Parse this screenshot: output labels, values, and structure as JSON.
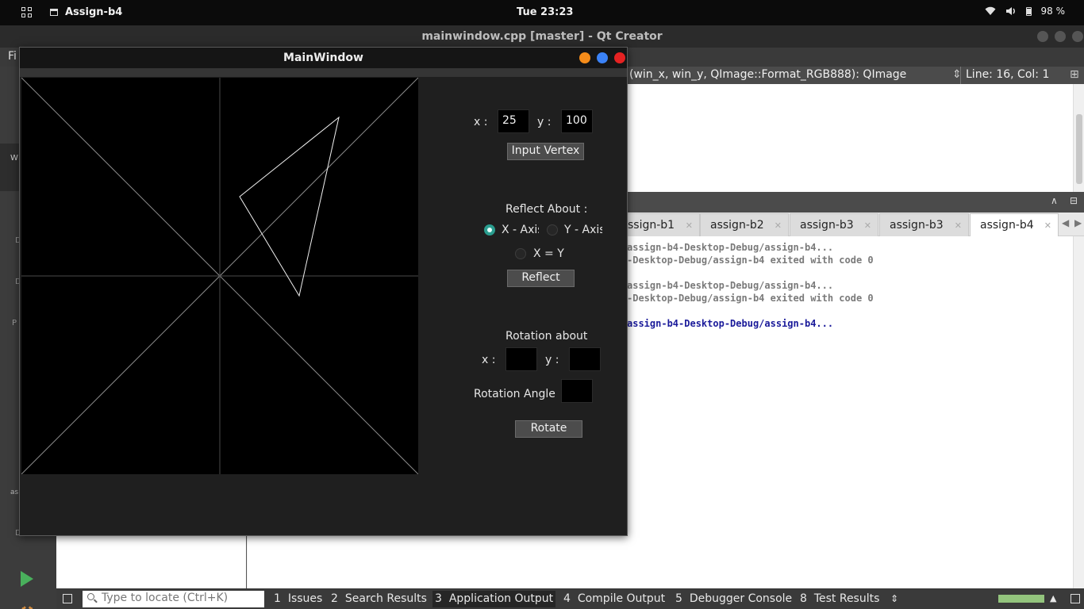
{
  "topbar": {
    "app_name": "Assign-b4",
    "clock": "Tue 23:23",
    "battery": "98 %",
    "icons": [
      "activities-grid-icon",
      "wifi-icon",
      "volume-icon",
      "battery-icon"
    ]
  },
  "qt": {
    "title": "mainwindow.cpp [master] - Qt Creator",
    "menu_first": "Fi",
    "editor_func": "(win_x, win_y, QImage::Format_RGB888): QImage",
    "line_col": "Line: 16, Col: 1",
    "output_tabs": [
      {
        "label": "ssign-b1"
      },
      {
        "label": "assign-b2"
      },
      {
        "label": "assign-b3"
      },
      {
        "label": "assign-b3"
      },
      {
        "label": "assign-b4"
      }
    ],
    "output_lines": [
      "assign-b4-Desktop-Debug/assign-b4...",
      "-Desktop-Debug/assign-b4 exited with code 0",
      "",
      "assign-b4-Desktop-Debug/assign-b4...",
      "-Desktop-Debug/assign-b4 exited with code 0",
      "",
      "assign-b4-Desktop-Debug/assign-b4..."
    ],
    "locator_placeholder": "Type to locate (Ctrl+K)",
    "status_buttons": [
      {
        "num": "1",
        "label": "Issues"
      },
      {
        "num": "2",
        "label": "Search Results"
      },
      {
        "num": "3",
        "label": "Application Output"
      },
      {
        "num": "4",
        "label": "Compile Output"
      },
      {
        "num": "5",
        "label": "Debugger Console"
      },
      {
        "num": "8",
        "label": "Test Results"
      }
    ],
    "sidebar_fragments": [
      "W",
      "D",
      "D",
      "P",
      "as",
      "D"
    ]
  },
  "mainwindow": {
    "title": "MainWindow",
    "vertex": {
      "x_label": "x :",
      "x_value": "25",
      "y_label": "y :",
      "y_value": "100",
      "button": "Input Vertex"
    },
    "reflect": {
      "heading": "Reflect About :",
      "opt_x": "X - Axis",
      "opt_y": "Y - Axis",
      "opt_xy": "X = Y",
      "selected": "X - Axis",
      "button": "Reflect"
    },
    "rotation": {
      "heading": "Rotation about",
      "x_label": "x :",
      "x_value": "",
      "y_label": "y :",
      "y_value": "",
      "angle_label": "Rotation Angle",
      "angle_value": "",
      "button": "Rotate"
    },
    "canvas": {
      "background": "#000000",
      "axis_color": "#4a4a4a",
      "diagonal_color": "#8a8a8a",
      "triangle": [
        [
          100,
          -25
        ],
        [
          25,
          100
        ],
        [
          150,
          200
        ]
      ]
    }
  }
}
